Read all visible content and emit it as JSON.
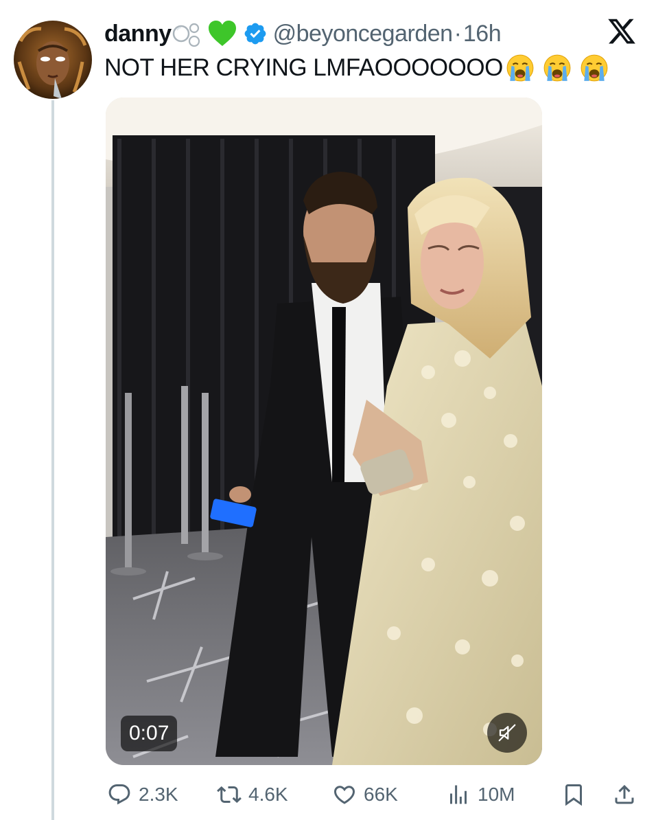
{
  "tweet": {
    "author": {
      "display_name": "danny",
      "name_emojis": [
        "bubbles-emoji",
        "green-heart-emoji"
      ],
      "handle": "@beyoncegarden",
      "separator": "·",
      "time": "16h",
      "verified": true
    },
    "text": "NOT HER CRYING LMFAOOOOOOO",
    "text_emojis": [
      "loudly-crying-face-emoji",
      "loudly-crying-face-emoji",
      "loudly-crying-face-emoji"
    ],
    "media": {
      "type": "video",
      "duration": "0:07",
      "muted": true
    },
    "actions": {
      "replies": "2.3K",
      "reposts": "4.6K",
      "likes": "66K",
      "views": "10M"
    }
  },
  "colors": {
    "text": "#0f1419",
    "secondary": "#536471",
    "verified_blue": "#1d9bf0",
    "green_heart": "#3ec62a",
    "thread_line": "#cfd9de"
  }
}
